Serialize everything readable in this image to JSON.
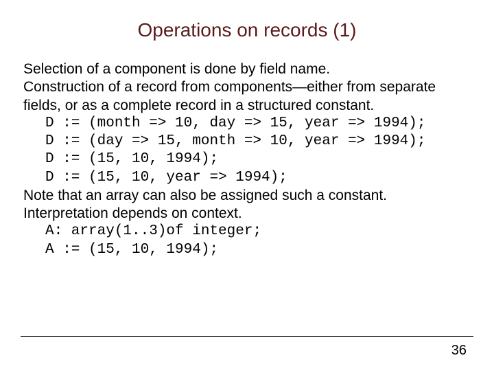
{
  "title": "Operations on records (1)",
  "para1": "Selection of a component is done by field name.",
  "para2": "Construction of a record from components—either from separate fields, or as a complete record in a structured constant.",
  "code1_l1": "D := (month => 10, day => 15, year => 1994);",
  "code1_l2": "D := (day => 15, month => 10, year => 1994);",
  "code1_l3": "D := (15, 10, 1994);",
  "code1_l4": "D := (15, 10, year => 1994);",
  "para3": "Note that an array can also be assigned such a constant. Interpretation depends on context.",
  "code2_l1": "A: array(1..3)of integer;",
  "code2_l2": "A := (15, 10, 1994);",
  "page_number": "36"
}
